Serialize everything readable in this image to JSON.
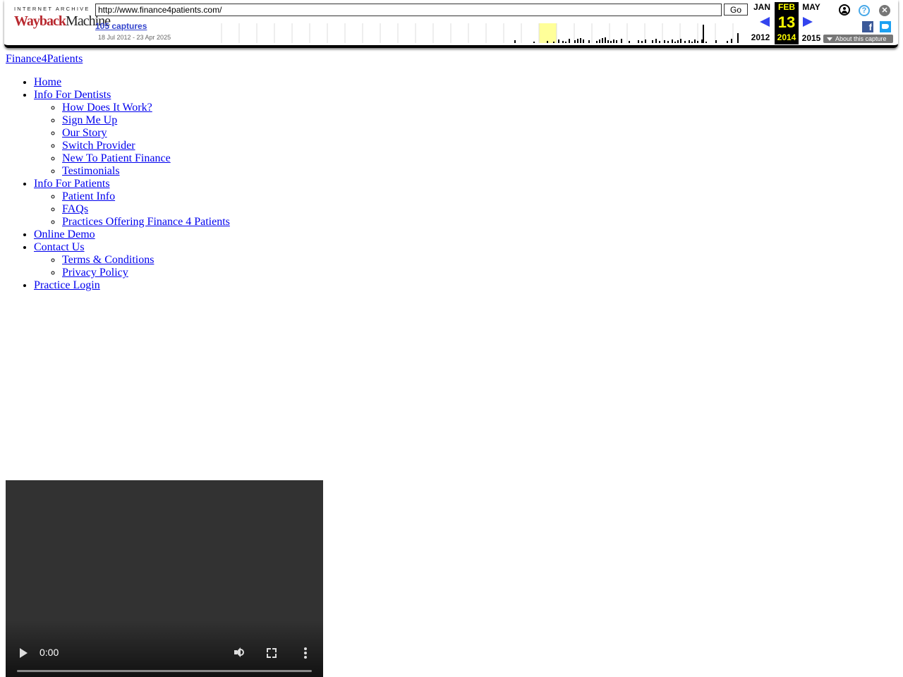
{
  "wayback": {
    "logo_top": "INTERNET ARCHIVE",
    "logo_wayback": "WaybackMachine",
    "url": "http://www.finance4patients.com/",
    "go_label": "Go",
    "captures_label": "105 captures",
    "date_range": "18 Jul 2012 - 23 Apr 2025",
    "prev_month": "JAN",
    "cur_month": "FEB",
    "next_month": "MAY",
    "cur_day": "13",
    "prev_year": "2012",
    "cur_year": "2014",
    "next_year": "2015",
    "about_label": "About this capture",
    "help_glyph": "?",
    "close_glyph": "✕",
    "facebook_glyph": "f",
    "highlight_color": "#ffff99",
    "accent_color": "#3344ee"
  },
  "page": {
    "logo_alt": "Finance4Patients",
    "nav": [
      {
        "label": "Home"
      },
      {
        "label": "Info For Dentists",
        "children": [
          "How Does It Work?",
          "Sign Me Up",
          "Our Story",
          "Switch Provider",
          "New To Patient Finance",
          "Testimonials"
        ]
      },
      {
        "label": "Info For Patients",
        "children": [
          "Patient Info",
          "FAQs",
          "Practices Offering Finance 4 Patients"
        ]
      },
      {
        "label": "Online Demo"
      },
      {
        "label": "Contact Us",
        "children": [
          "Terms & Conditions",
          "Privacy Policy"
        ]
      },
      {
        "label": "Practice Login"
      }
    ]
  },
  "video": {
    "time": "0:00"
  }
}
